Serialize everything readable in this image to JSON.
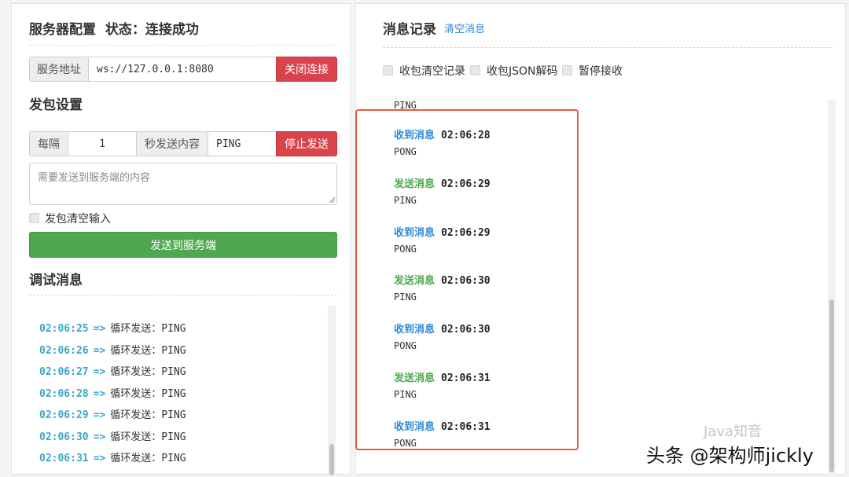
{
  "server_config": {
    "title": "服务器配置",
    "status_label": "状态：",
    "status_value": "连接成功",
    "address_label": "服务地址",
    "address_value": "ws://127.0.0.1:8080",
    "close_button": "关闭连接"
  },
  "send_settings": {
    "title": "发包设置",
    "interval_prefix": "每隔",
    "interval_value": "1",
    "interval_suffix": "秒发送内容",
    "content_value": "PING",
    "stop_button": "停止发送",
    "textarea_placeholder": "需要发送到服务端的内容",
    "clear_input_label": "发包清空输入",
    "send_button": "发送到服务端"
  },
  "debug": {
    "title": "调试消息",
    "arrow": "=>",
    "entries": [
      {
        "time": "02:06:25",
        "text": "循环发送：",
        "value": "PING"
      },
      {
        "time": "02:06:26",
        "text": "循环发送：",
        "value": "PING"
      },
      {
        "time": "02:06:27",
        "text": "循环发送：",
        "value": "PING"
      },
      {
        "time": "02:06:28",
        "text": "循环发送：",
        "value": "PING"
      },
      {
        "time": "02:06:29",
        "text": "循环发送：",
        "value": "PING"
      },
      {
        "time": "02:06:30",
        "text": "循环发送：",
        "value": "PING"
      },
      {
        "time": "02:06:31",
        "text": "循环发送：",
        "value": "PING"
      }
    ]
  },
  "messages": {
    "title": "消息记录",
    "clear_link": "清空消息",
    "options": [
      "收包清空记录",
      "收包JSON解码",
      "暂停接收"
    ],
    "partial_top": "PING",
    "items": [
      {
        "type": "收到消息",
        "kind": "recv",
        "time": "02:06:28",
        "body": "PONG"
      },
      {
        "type": "发送消息",
        "kind": "sent",
        "time": "02:06:29",
        "body": "PING"
      },
      {
        "type": "收到消息",
        "kind": "recv",
        "time": "02:06:29",
        "body": "PONG"
      },
      {
        "type": "发送消息",
        "kind": "sent",
        "time": "02:06:30",
        "body": "PING"
      },
      {
        "type": "收到消息",
        "kind": "recv",
        "time": "02:06:30",
        "body": "PONG"
      },
      {
        "type": "发送消息",
        "kind": "sent",
        "time": "02:06:31",
        "body": "PING"
      },
      {
        "type": "收到消息",
        "kind": "recv",
        "time": "02:06:31",
        "body": "PONG"
      }
    ]
  },
  "watermark": {
    "main": "头条 @架构师jickly",
    "faint": "Java知音"
  },
  "colors": {
    "accent_red": "#d9434b",
    "accent_green": "#4fa84f",
    "link_blue": "#2d8ad8",
    "debug_time": "#3aa6c8",
    "highlight_border": "#e25a3f"
  }
}
